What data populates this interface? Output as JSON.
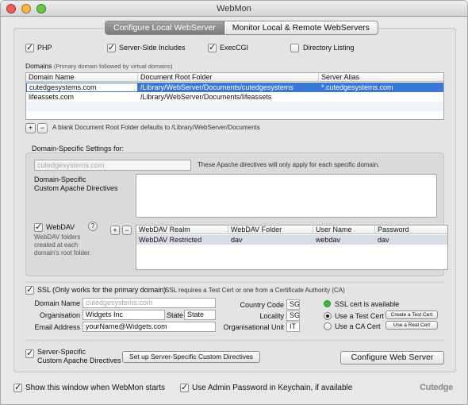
{
  "window": {
    "title": "WebMon"
  },
  "tabs": [
    {
      "label": "Configure Local WebServer",
      "selected": true
    },
    {
      "label": "Monitor Local & Remote WebServers",
      "selected": false
    }
  ],
  "options": {
    "php": {
      "label": "PHP",
      "checked": true
    },
    "ssi": {
      "label": "Server-Side Includes",
      "checked": true
    },
    "execcgi": {
      "label": "ExecCGI",
      "checked": true
    },
    "dirlist": {
      "label": "Directory Listing",
      "checked": false
    }
  },
  "domains": {
    "heading": "Domains",
    "subheading": "(Primary domain followed by virtual domains)",
    "columns": [
      "Domain Name",
      "Document Root Folder",
      "Server Alias"
    ],
    "rows": [
      {
        "name": "cutedgesystems.com",
        "root": "/Library/WebServer/Documents/cutedgesystems",
        "alias": "*.cutedgesystems.com",
        "selected": true
      },
      {
        "name": "lifeassets.com",
        "root": "/Library/WebServer/Documents/lifeassets",
        "alias": "",
        "selected": false
      }
    ],
    "add_label": "+",
    "remove_label": "−",
    "note": "A blank Document Root Folder defaults to /Library/WebServer/Documents"
  },
  "domain_specific": {
    "heading": "Domain-Specific Settings for:",
    "domain_placeholder": "cutedgesystems.com",
    "note": "These Apache directives will only apply for each specific domain.",
    "directives_label_1": "Domain-Specific",
    "directives_label_2": "Custom Apache Directives",
    "webdav": {
      "label": "WebDAV",
      "checked": true,
      "help": "?",
      "desc_1": "WebDAV folders",
      "desc_2": "created at each",
      "desc_3": "domain's root folder.",
      "add_label": "+",
      "remove_label": "−",
      "columns": [
        "WebDAV Realm",
        "WebDAV Folder",
        "User Name",
        "Password"
      ],
      "rows": [
        {
          "realm": "WebDAV Restricted",
          "folder": "dav",
          "user": "webdav",
          "password": "dav"
        }
      ]
    }
  },
  "ssl": {
    "checked": true,
    "label": "SSL (Only works for the primary domain)",
    "note": "SSL requires a Test Cert or one from a Certificate Authority (CA)",
    "domain_label": "Domain Name",
    "domain_placeholder": "cutedgesystems.com",
    "org_label": "Organisation",
    "org_value": "Widgets Inc",
    "state_label": "State",
    "state_value": "State",
    "email_label": "Email Address",
    "email_value": "yourName@Widgets.com",
    "country_label": "Country Code",
    "country_value": "SG",
    "locality_label": "Locality",
    "locality_value": "SG",
    "ou_label": "Organisational Unit",
    "ou_value": "IT",
    "status_text": "SSL cert is available",
    "status_color": "#3dbb3d",
    "test_cert_label": "Use a Test Cert",
    "test_cert_selected": true,
    "ca_cert_label": "Use a CA Cert",
    "create_test_cert_label": "Create a Test Cert",
    "use_real_cert_label": "Use a Real Cert"
  },
  "server_specific": {
    "checked": true,
    "label_1": "Server-Specific",
    "label_2": "Custom Apache Directives",
    "setup_button": "Set up Server-Specific Custom Directives",
    "configure_button": "Configure Web Server"
  },
  "footer": {
    "show_window": {
      "label": "Show this window when WebMon starts",
      "checked": true
    },
    "keychain": {
      "label": "Use Admin Password in Keychain, if available",
      "checked": true
    },
    "brand": "Cutedge"
  },
  "colors": {
    "selection": "#3b78d6",
    "alt_row": "#f0f4fa"
  }
}
